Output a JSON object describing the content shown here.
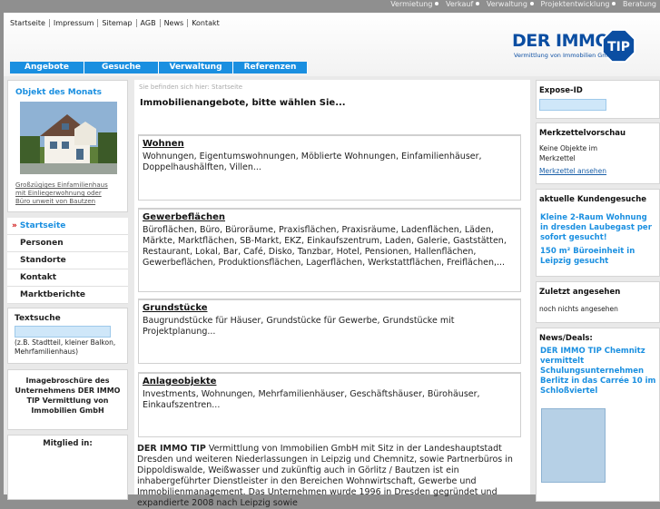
{
  "topnav": [
    "Vermietung",
    "Verkauf",
    "Verwaltung",
    "Projektentwicklung",
    "Beratung"
  ],
  "metanav": [
    "Startseite",
    "Impressum",
    "Sitemap",
    "AGB",
    "News",
    "Kontakt"
  ],
  "logo": {
    "name": "DER IMMO",
    "badge": "TIP",
    "sub": "Vermittlung von Immobilien GmbH",
    "color": "#0b4ea2"
  },
  "tabs": [
    "Angebote",
    "Gesuche",
    "Verwaltung",
    "Referenzen"
  ],
  "left": {
    "feature_title": "Objekt des Monats",
    "feature_caption": "Großzügiges Einfamilienhaus mit Einliegerwohnung oder Büro unweit von Bautzen",
    "menu": [
      "Startseite",
      "Personen",
      "Standorte",
      "Kontakt",
      "Marktberichte"
    ],
    "search_title": "Textsuche",
    "search_hint": "(z.B. Stadtteil, kleiner Balkon, Mehrfamilienhaus)",
    "brochure": "Imagebroschüre des Unternehmens DER IMMO TIP Vermittlung von Immobilien GmbH",
    "member": "Mitglied in:"
  },
  "main": {
    "breadcrumb": "Sie befinden sich hier:  Startseite",
    "title": "Immobilienangebote, bitte wählen Sie...",
    "categories": [
      {
        "title": "Wohnen",
        "text": "Wohnungen, Eigentumswohnungen, Möblierte Wohnungen, Einfamilienhäuser, Doppelhaushälften, Villen..."
      },
      {
        "title": "Gewerbeflächen",
        "text": "Büroflächen, Büro, Büroräume, Praxisflächen, Praxisräume, Ladenflächen, Läden, Märkte, Marktflächen, SB-Markt, EKZ, Einkaufszentrum, Laden, Galerie, Gaststätten, Restaurant, Lokal, Bar, Café, Disko, Tanzbar, Hotel, Pensionen, Hallenflächen, Gewerbeflächen, Produktionsflächen, Lagerflächen, Werkstattflächen, Freiflächen,..."
      },
      {
        "title": "Grundstücke",
        "text": "Baugrundstücke für Häuser, Grundstücke für Gewerbe, Grundstücke mit Projektplanung..."
      },
      {
        "title": "Anlageobjekte",
        "text": "Investments, Wohnungen, Mehrfamilienhäuser, Geschäftshäuser, Bürohäuser, Einkaufszentren..."
      }
    ],
    "intro_bold": "DER IMMO TIP",
    "intro": " Vermittlung von Immobilien GmbH mit Sitz in der Landeshauptstadt Dresden und weiteren Niederlassungen in Leipzig und Chemnitz, sowie Partnerbüros in Dippoldiswalde, Weißwasser und zukünftig auch in Görlitz / Bautzen ist ein inhabergeführter Dienstleister in den Bereichen Wohnwirtschaft, Gewerbe und Immobilienmanagement. Das Unternehmen wurde 1996 in Dresden gegründet und expandierte 2008 nach Leipzig sowie"
  },
  "right": {
    "expose_title": "Expose-ID",
    "merk_title": "Merkzettelvorschau",
    "merk_text": "Keine Objekte im Merkzettel",
    "merk_link": "Merkzettel ansehen",
    "gesuche_title": "aktuelle Kundengesuche",
    "gesuche": [
      "Kleine 2-Raum Wohnung in dresden Laubegast per sofort gesucht!",
      "150 m² Büroeinheit in Leipzig gesucht"
    ],
    "zuletzt_title": "Zuletzt angesehen",
    "zuletzt_text": "noch nichts angesehen",
    "news_title": "News/Deals:",
    "news": "DER IMMO TIP Chemnitz vermittelt Schulungsunternehmen Berlitz in das Carrée 10 im Schloßviertel"
  },
  "colors": {
    "accent": "#1a8fe0",
    "frame": "#8f8f8f"
  }
}
